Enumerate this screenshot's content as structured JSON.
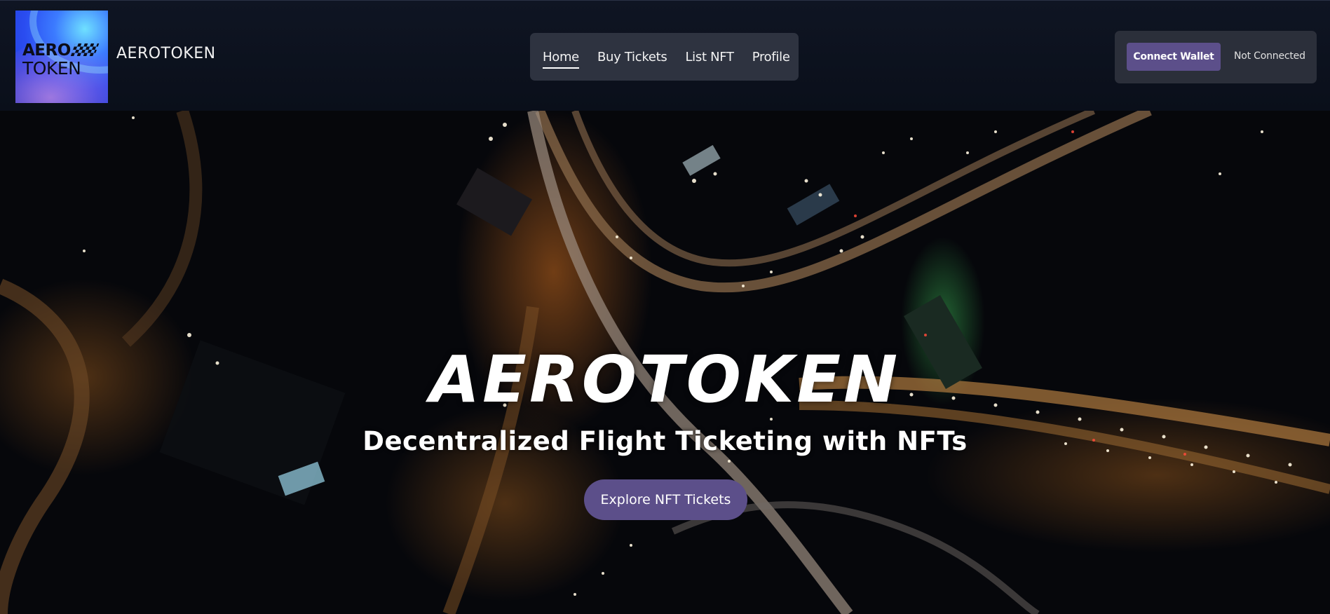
{
  "header": {
    "logo": {
      "line1": "AERO",
      "line2": "TOKEN"
    },
    "brand_name": "AEROTOKEN",
    "nav": [
      {
        "label": "Home",
        "active": true
      },
      {
        "label": "Buy Tickets",
        "active": false
      },
      {
        "label": "List NFT",
        "active": false
      },
      {
        "label": "Profile",
        "active": false
      }
    ],
    "wallet": {
      "connect_label": "Connect Wallet",
      "status": "Not Connected"
    }
  },
  "hero": {
    "title": "AEROTOKEN",
    "subtitle": "Decentralized Flight Ticketing with NFTs",
    "cta_label": "Explore NFT Tickets",
    "background_description_icon": "night-city-aerial-image"
  },
  "colors": {
    "accent": "#5c4f8a",
    "header_bg": "#0f1523",
    "nav_bg": "#2e3340",
    "wallet_bg": "#2b2f3a"
  }
}
